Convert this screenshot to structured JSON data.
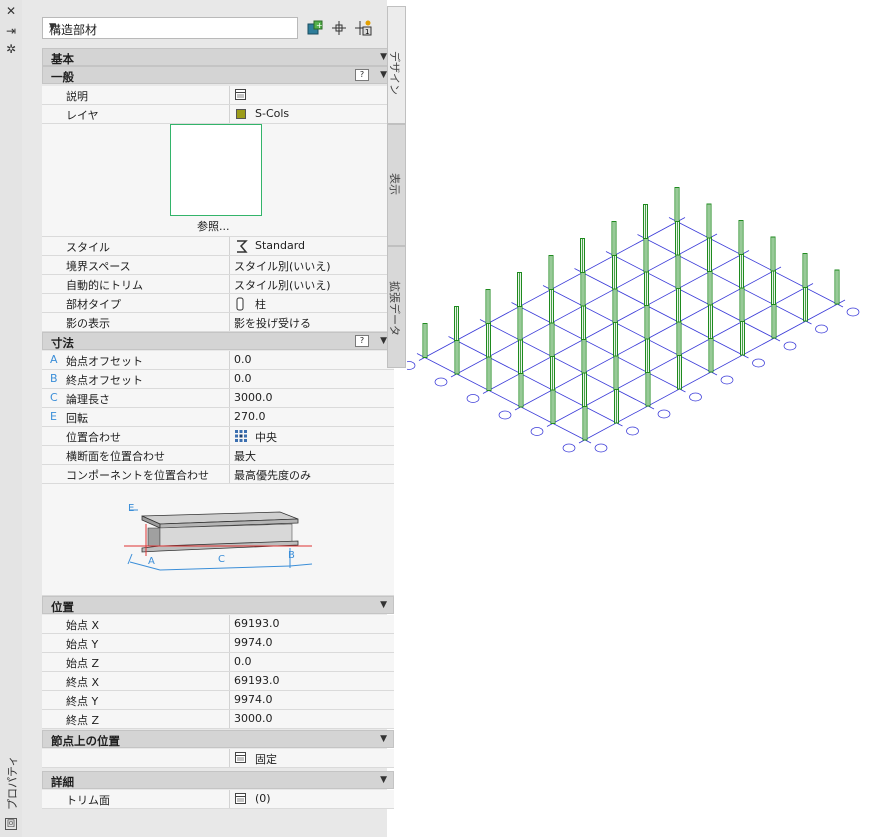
{
  "palette": {
    "title": "プロパティ"
  },
  "object_type": "構造部材",
  "side_tabs": [
    "デザイン",
    "表示",
    "拡張データ"
  ],
  "sections": {
    "basic": "基本",
    "general": "一般",
    "dimensions": "寸法",
    "location": "位置",
    "node_location": "節点上の位置",
    "details": "詳細"
  },
  "general": {
    "description_label": "説明",
    "layer_label": "レイヤ",
    "layer_value": "S-Cols",
    "browse_label": "参照...",
    "style_label": "スタイル",
    "style_value": "Standard",
    "boundary_label": "境界スペース",
    "boundary_value": "スタイル別(いいえ)",
    "autotrim_label": "自動的にトリム",
    "autotrim_value": "スタイル別(いいえ)",
    "member_type_label": "部材タイプ",
    "member_type_value": "柱",
    "shadow_label": "影の表示",
    "shadow_value": "影を投げ受ける"
  },
  "dimensions": {
    "start_offset": {
      "key": "A",
      "label": "始点オフセット",
      "value": "0.0"
    },
    "end_offset": {
      "key": "B",
      "label": "終点オフセット",
      "value": "0.0"
    },
    "logical_length": {
      "key": "C",
      "label": "論理長さ",
      "value": "3000.0"
    },
    "rotation": {
      "key": "E",
      "label": "回転",
      "value": "270.0"
    },
    "justify_label": "位置合わせ",
    "justify_value": "中央",
    "justify_section_label": "横断面を位置合わせ",
    "justify_section_value": "最大",
    "justify_component_label": "コンポーネントを位置合わせ",
    "justify_component_value": "最高優先度のみ",
    "diagram_labels": {
      "e": "E",
      "a": "A",
      "c": "C",
      "b": "B"
    }
  },
  "location": {
    "rows": [
      {
        "label": "始点 X",
        "value": "69193.0"
      },
      {
        "label": "始点 Y",
        "value": "9974.0"
      },
      {
        "label": "始点 Z",
        "value": "0.0"
      },
      {
        "label": "終点 X",
        "value": "69193.0"
      },
      {
        "label": "終点 Y",
        "value": "9974.0"
      },
      {
        "label": "終点 Z",
        "value": "3000.0"
      }
    ]
  },
  "node_location": {
    "value": "固定"
  },
  "details": {
    "trim_label": "トリム面",
    "trim_value": "(0)"
  },
  "colors": {
    "column": "#1f8a1f",
    "grid": "#3a3ad8",
    "bubble": "#3a3ad8",
    "thumbnail_border": "#33b46a",
    "accent_key": "#3b8ed8",
    "layer_swatch": "#9c9c1a"
  }
}
